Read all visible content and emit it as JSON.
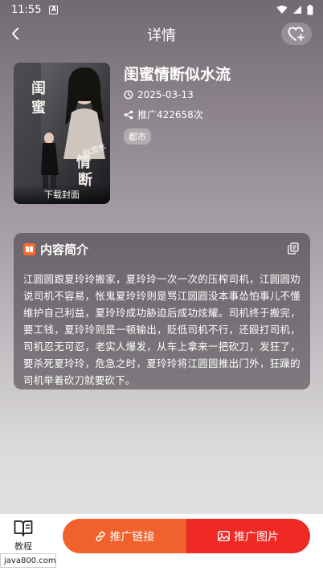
{
  "status_bar": {
    "time": "11:55",
    "notification_icon": "a-square-icon",
    "icons": [
      "wifi-icon",
      "signal-icon",
      "battery-icon"
    ]
  },
  "nav": {
    "title": "详情",
    "back_icon": "chevron-left-icon",
    "favorite_icon": "heart-plus-icon"
  },
  "drama": {
    "cover_caption": "下载封面",
    "cover_text": {
      "line1": "闺",
      "line2": "蜜",
      "line3": "似流水",
      "line4": "情",
      "line5": "断"
    },
    "title": "闺蜜情断似水流",
    "date": "2025-03-13",
    "promo_count": "推广422658次",
    "genre": "都市"
  },
  "intro": {
    "title": "内容简介",
    "text": "江圆圆跟夏玲玲搬家，夏玲玲一次一次的压榨司机，江圆圆劝说司机不容易，怅鬼夏玲玲则是骂江圆圆没本事怂怕事儿不懂维护自己利益，夏玲玲成功胁迫后成功炫耀。司机终于搬完，要工钱，夏玲玲则是一顿输出，贬低司机不行，还殴打司机，司机忍无可忍，老实人爆发，从车上拿来一把砍刀，发狂了，要杀死夏玲玲，危急之时，夏玲玲将江圆圆推出门外，狂躁的司机举着砍刀就要砍下。"
  },
  "bottom": {
    "tutorial_label": "教程",
    "promo_link_label": "推广链接",
    "promo_image_label": "推广图片"
  },
  "watermark": "java800.com",
  "colors": {
    "link_button": "#f0612c",
    "image_button": "#ef2a25",
    "intro_icon": "#ff6a2a"
  }
}
